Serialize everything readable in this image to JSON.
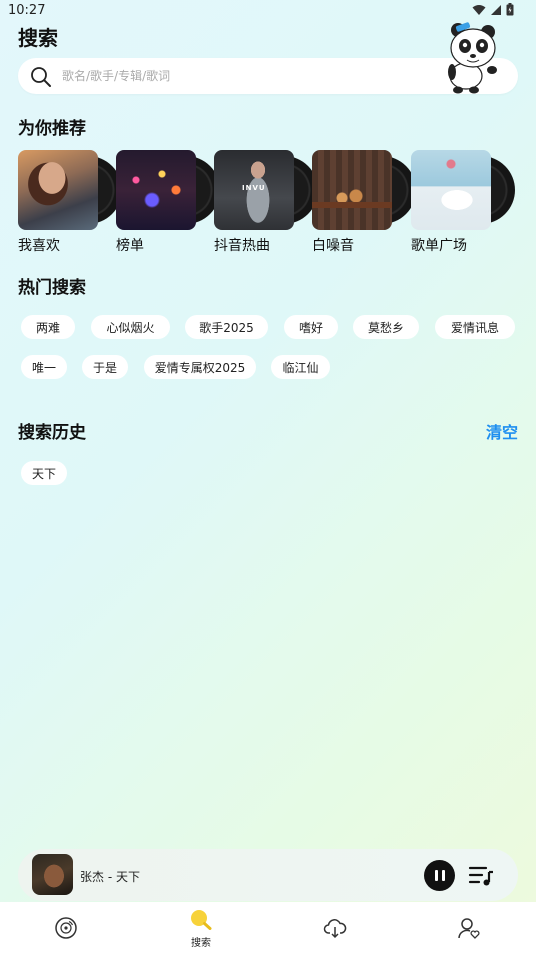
{
  "status_bar": {
    "time": "10:27"
  },
  "header": {
    "title": "搜索"
  },
  "search": {
    "placeholder": "歌名/歌手/专辑/歌词"
  },
  "recommend": {
    "title": "为你推荐",
    "items": [
      {
        "label": "我喜欢"
      },
      {
        "label": "榜单"
      },
      {
        "label": "抖音热曲",
        "cover_text": "INVU"
      },
      {
        "label": "白噪音"
      },
      {
        "label": "歌单广场"
      }
    ]
  },
  "hot_search": {
    "title": "热门搜索",
    "chips": [
      "两难",
      "心似烟火",
      "歌手2025",
      "嗜好",
      "莫愁乡",
      "爱情讯息",
      "唯一",
      "于是",
      "爱情专属权2025",
      "临江仙"
    ]
  },
  "history": {
    "title": "搜索历史",
    "clear_label": "清空",
    "chips": [
      "天下"
    ]
  },
  "player": {
    "title": "张杰 - 天下",
    "state": "playing"
  },
  "tab_bar": {
    "tabs": [
      {
        "icon": "disc-icon",
        "label": ""
      },
      {
        "icon": "search-tab-icon",
        "label": "搜索",
        "active": true
      },
      {
        "icon": "cloud-download-icon",
        "label": ""
      },
      {
        "icon": "user-heart-icon",
        "label": ""
      }
    ]
  },
  "colors": {
    "accent": "#1f8ff0",
    "active_tab": "#f7d23a"
  }
}
